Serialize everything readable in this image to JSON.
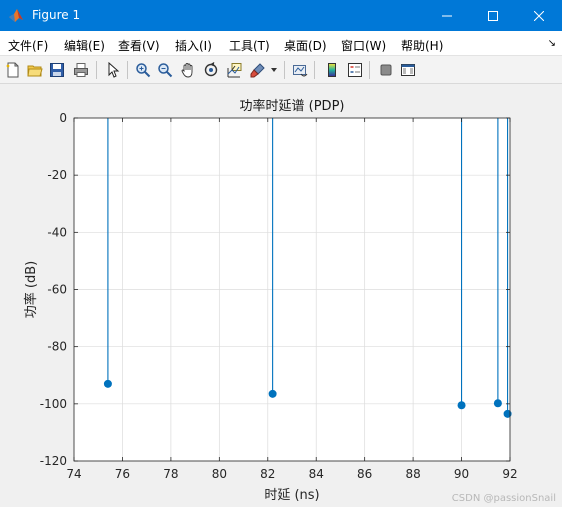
{
  "window": {
    "title": "Figure 1",
    "minimize_icon": "minimize-icon",
    "maximize_icon": "maximize-icon",
    "close_icon": "close-icon"
  },
  "menu": {
    "items": [
      {
        "label": "文件(F)"
      },
      {
        "label": "编辑(E)"
      },
      {
        "label": "查看(V)"
      },
      {
        "label": "插入(I)"
      },
      {
        "label": "工具(T)"
      },
      {
        "label": "桌面(D)"
      },
      {
        "label": "窗口(W)"
      },
      {
        "label": "帮助(H)"
      }
    ],
    "overflow_icon": "menu-overflow-arrow-icon"
  },
  "toolbar": {
    "icons": [
      "new-figure-icon",
      "open-file-icon",
      "save-icon",
      "print-icon",
      "pointer-icon",
      "zoom-in-icon",
      "zoom-out-icon",
      "pan-hand-icon",
      "rotate-3d-icon",
      "data-cursor-icon",
      "brush-icon",
      "brush-dropdown-icon",
      "link-plot-icon",
      "colorbar-icon",
      "legend-icon",
      "hide-plot-tools-icon",
      "show-plot-tools-icon"
    ]
  },
  "chart_data": {
    "type": "stem",
    "title": "功率时延谱 (PDP)",
    "xlabel": "时延 (ns)",
    "ylabel": "功率 (dB)",
    "xlim": [
      74,
      92
    ],
    "ylim": [
      -120,
      0
    ],
    "xticks": [
      74,
      76,
      78,
      80,
      82,
      84,
      86,
      88,
      90,
      92
    ],
    "yticks": [
      0,
      -20,
      -40,
      -60,
      -80,
      -100,
      -120
    ],
    "grid": true,
    "color": "#0072bd",
    "baseline": 0,
    "points": [
      {
        "x": 75.4,
        "y": -93
      },
      {
        "x": 82.2,
        "y": -96.5
      },
      {
        "x": 90.0,
        "y": -100.5
      },
      {
        "x": 91.5,
        "y": -99.8
      },
      {
        "x": 91.9,
        "y": -103.5
      }
    ]
  },
  "watermark": "CSDN @passionSnail"
}
